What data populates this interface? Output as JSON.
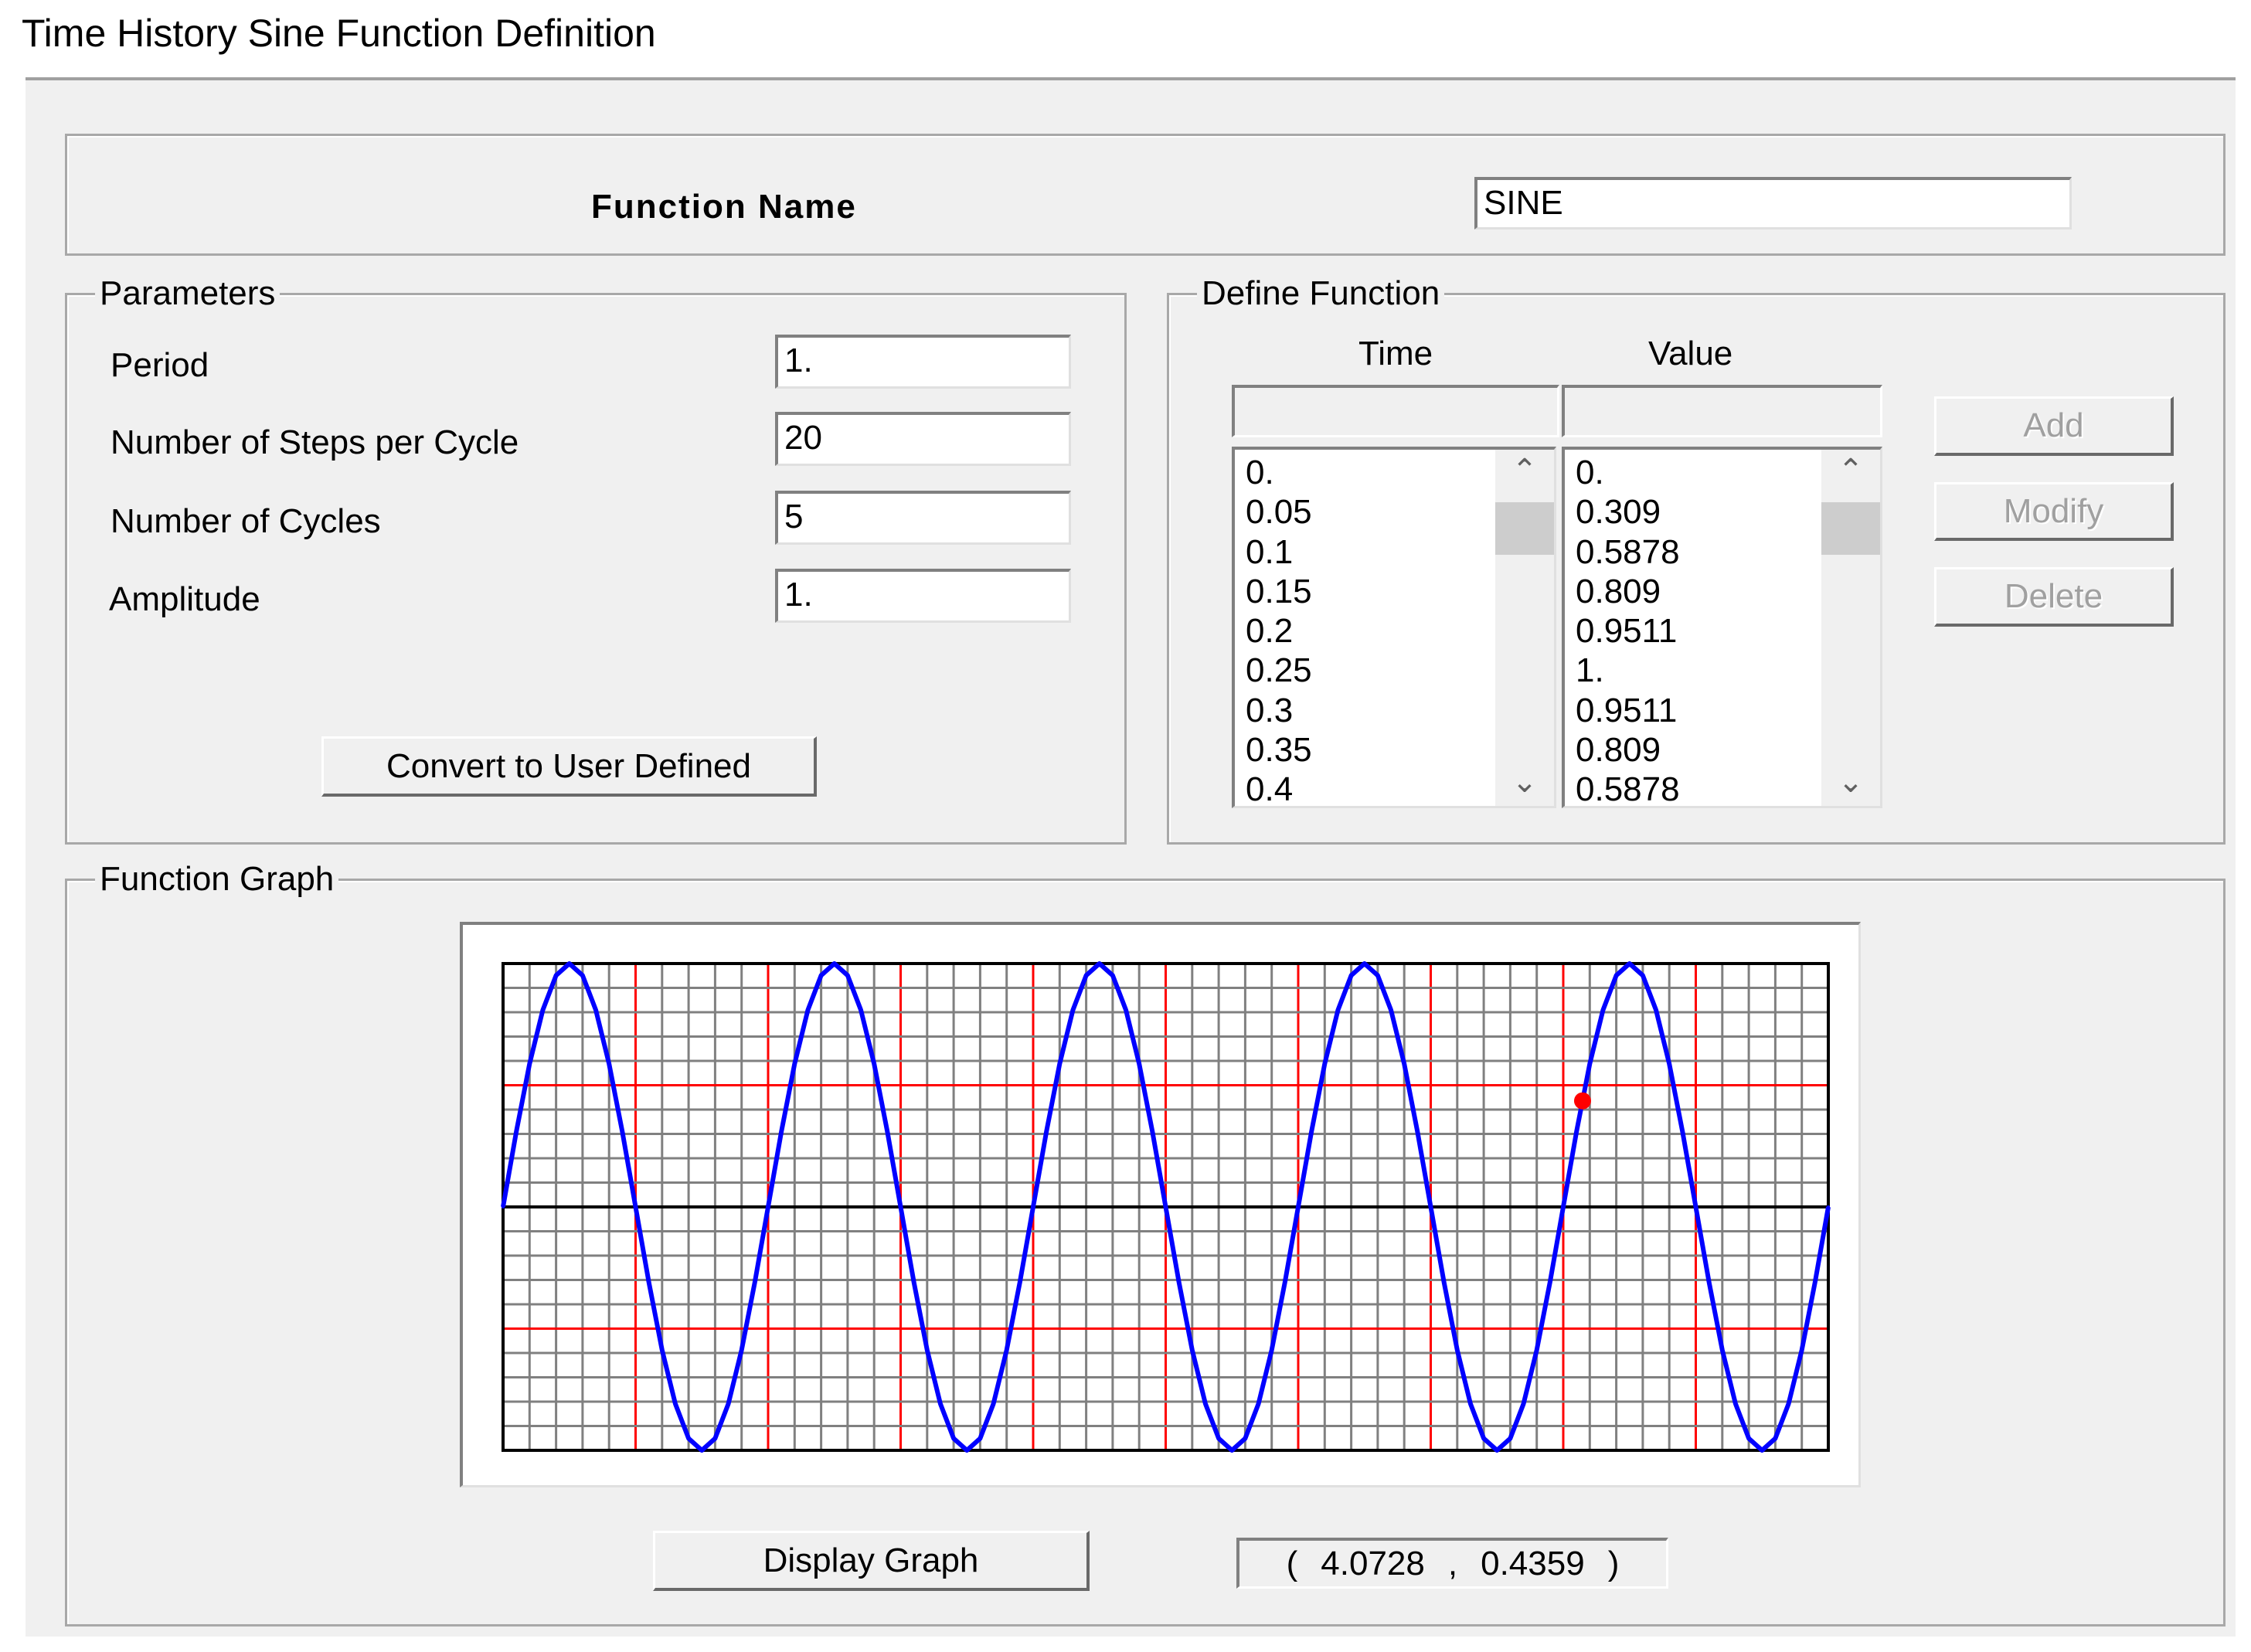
{
  "window": {
    "title": "Time History Sine Function Definition"
  },
  "function_name": {
    "label": "Function Name",
    "value": "SINE"
  },
  "parameters": {
    "legend": "Parameters",
    "fields": [
      {
        "label": "Period",
        "value": "1."
      },
      {
        "label": "Number of Steps per Cycle",
        "value": "20"
      },
      {
        "label": "Number of Cycles",
        "value": "5"
      },
      {
        "label": "Amplitude",
        "value": "1."
      }
    ],
    "convert_button": "Convert to User Defined"
  },
  "define_function": {
    "legend": "Define Function",
    "time_header": "Time",
    "value_header": "Value",
    "time_input": "",
    "value_input": "",
    "time_list": [
      "0.",
      "0.05",
      "0.1",
      "0.15",
      "0.2",
      "0.25",
      "0.3",
      "0.35",
      "0.4"
    ],
    "value_list": [
      "0.",
      "0.309",
      "0.5878",
      "0.809",
      "0.9511",
      "1.",
      "0.9511",
      "0.809",
      "0.5878"
    ],
    "buttons": {
      "add": "Add",
      "modify": "Modify",
      "delete": "Delete"
    }
  },
  "function_graph": {
    "legend": "Function Graph",
    "display_button": "Display Graph",
    "readout": {
      "open": "(",
      "x": "4.0728",
      "sep": ",",
      "y": "0.4359",
      "close": ")"
    }
  },
  "colors": {
    "curve": "#0000ff",
    "grid": "#808080",
    "major_grid": "#ff0000",
    "axis": "#000000",
    "cursor": "#ff0000"
  },
  "chart_data": {
    "type": "line",
    "title": "",
    "xlabel": "",
    "ylabel": "",
    "xlim": [
      0,
      5
    ],
    "ylim": [
      -1,
      1
    ],
    "x_step": 0.05,
    "grid": {
      "x_minor": 0.1,
      "x_major": 0.5,
      "y_minor": 0.1,
      "y_major": 0.5
    },
    "cursor": {
      "x": 4.0728,
      "y": 0.4359
    },
    "cycle_values": [
      0,
      0.309,
      0.5878,
      0.809,
      0.9511,
      1,
      0.9511,
      0.809,
      0.5878,
      0.309,
      0,
      -0.309,
      -0.5878,
      -0.809,
      -0.9511,
      -1,
      -0.9511,
      -0.809,
      -0.5878,
      -0.309
    ],
    "values": [
      0,
      0.309,
      0.5878,
      0.809,
      0.9511,
      1,
      0.9511,
      0.809,
      0.5878,
      0.309,
      0,
      -0.309,
      -0.5878,
      -0.809,
      -0.9511,
      -1,
      -0.9511,
      -0.809,
      -0.5878,
      -0.309,
      0,
      0.309,
      0.5878,
      0.809,
      0.9511,
      1,
      0.9511,
      0.809,
      0.5878,
      0.309,
      0,
      -0.309,
      -0.5878,
      -0.809,
      -0.9511,
      -1,
      -0.9511,
      -0.809,
      -0.5878,
      -0.309,
      0,
      0.309,
      0.5878,
      0.809,
      0.9511,
      1,
      0.9511,
      0.809,
      0.5878,
      0.309,
      0,
      -0.309,
      -0.5878,
      -0.809,
      -0.9511,
      -1,
      -0.9511,
      -0.809,
      -0.5878,
      -0.309,
      0,
      0.309,
      0.5878,
      0.809,
      0.9511,
      1,
      0.9511,
      0.809,
      0.5878,
      0.309,
      0,
      -0.309,
      -0.5878,
      -0.809,
      -0.9511,
      -1,
      -0.9511,
      -0.809,
      -0.5878,
      -0.309,
      0,
      0.309,
      0.5878,
      0.809,
      0.9511,
      1,
      0.9511,
      0.809,
      0.5878,
      0.309,
      0,
      -0.309,
      -0.5878,
      -0.809,
      -0.9511,
      -1,
      -0.9511,
      -0.809,
      -0.5878,
      -0.309,
      0
    ]
  }
}
